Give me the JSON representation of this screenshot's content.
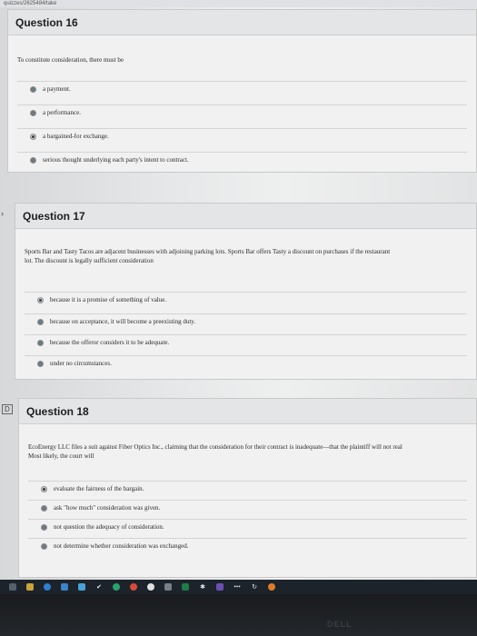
{
  "browser": {
    "url_fragment": "quizzes/2625484/take"
  },
  "questions": [
    {
      "title": "Question 16",
      "text": "To constitute consideration, there must be",
      "options": [
        {
          "label": "a payment.",
          "selected": false
        },
        {
          "label": "a performance.",
          "selected": false
        },
        {
          "label": "a bargained-for exchange.",
          "selected": true
        },
        {
          "label": "serious thought underlying each party's intent to contract.",
          "selected": false
        }
      ]
    },
    {
      "title": "Question 17",
      "text_lines": [
        "Sports Bar and Tasty Tacos are adjacent businesses with adjoining parking lots. Sports Bar offers Tasty a discount on purchases if the restaurant",
        "lot. The discount is legally sufficient consideration"
      ],
      "options": [
        {
          "label": "because it is a promise of something of value.",
          "selected": true
        },
        {
          "label": "because on acceptance, it will become a preexisting duty.",
          "selected": false
        },
        {
          "label": "because the offeror considers it to be adequate.",
          "selected": false
        },
        {
          "label": "under no circumstances.",
          "selected": false
        }
      ]
    },
    {
      "title": "Question 18",
      "text_lines": [
        "EcoEnergy LLC files a suit against Fiber Optics Inc., claiming that the consideration for their contract is inadequate—that the plaintiff will not real",
        "Most likely, the court will"
      ],
      "options": [
        {
          "label": "evaluate the fairness of the bargain.",
          "selected": true
        },
        {
          "label": "ask \"how much\" consideration was given.",
          "selected": false
        },
        {
          "label": "not question the adequacy of consideration.",
          "selected": false
        },
        {
          "label": "not determine whether consideration was exchanged.",
          "selected": false
        }
      ]
    }
  ],
  "side_marks": {
    "q17": "›",
    "q18": "D"
  },
  "bezel": {
    "brand": "DELL"
  },
  "colors": {
    "page": "#e6e7e8",
    "card": "#f1f1f1",
    "taskbar": "#1c232b"
  }
}
